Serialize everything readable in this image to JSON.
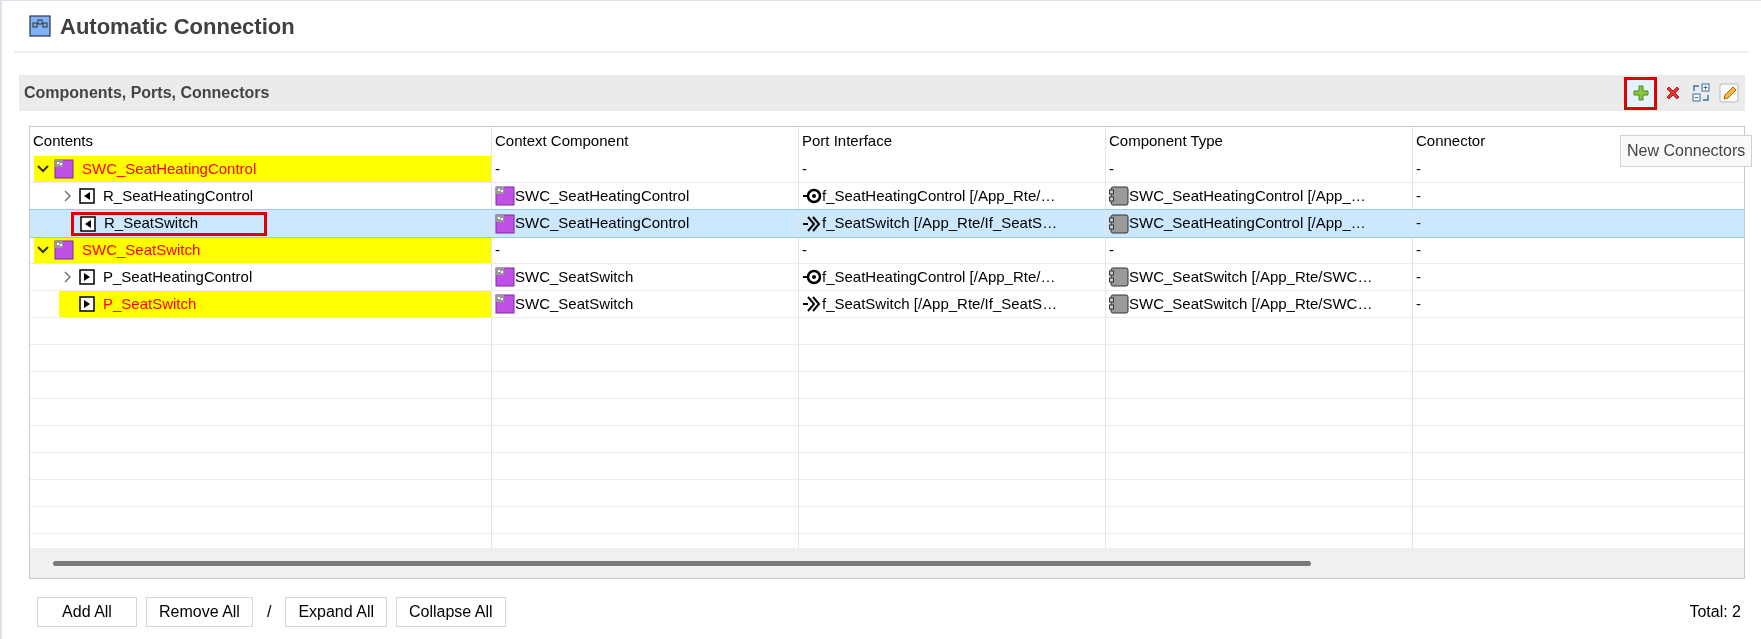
{
  "window": {
    "title": "Automatic Connection"
  },
  "section": {
    "title": "Components, Ports, Connectors"
  },
  "toolbar": [
    {
      "kind": "add",
      "marked": true
    },
    {
      "kind": "delete",
      "marked": false
    },
    {
      "kind": "expand-collapse",
      "marked": false
    },
    {
      "kind": "edit",
      "marked": false
    }
  ],
  "tooltip": "New Connectors",
  "table": {
    "columns": [
      "Contents",
      "Context Component",
      "Port Interface",
      "Component Type",
      "Connector"
    ],
    "rows": [
      {
        "kind": "component",
        "highlighted": true,
        "selected": false,
        "marked": false,
        "expanded": true,
        "cells": [
          {
            "text": "SWC_SeatHeatingControl"
          },
          {
            "text": "-"
          },
          {
            "text": "-"
          },
          {
            "text": "-"
          },
          {
            "text": "-"
          }
        ],
        "children": [
          {
            "kind": "r-port",
            "highlighted": false,
            "selected": false,
            "marked": false,
            "expanded": false,
            "cells": [
              {
                "text": "R_SeatHeatingControl"
              },
              {
                "text": "SWC_SeatHeatingControl"
              },
              {
                "text": "f_SeatHeatingControl [/App_Rte/…",
                "kind": "client-server"
              },
              {
                "text": "SWC_SeatHeatingControl [/App_…"
              },
              {
                "text": "-"
              }
            ]
          },
          {
            "kind": "r-port",
            "highlighted": false,
            "selected": true,
            "marked": true,
            "cells": [
              {
                "text": "R_SeatSwitch"
              },
              {
                "text": "SWC_SeatHeatingControl"
              },
              {
                "text": "f_SeatSwitch [/App_Rte/If_SeatS…",
                "kind": "sender-receiver"
              },
              {
                "text": "SWC_SeatHeatingControl [/App_…"
              },
              {
                "text": "-"
              }
            ]
          }
        ]
      },
      {
        "kind": "component",
        "highlighted": true,
        "selected": false,
        "marked": false,
        "expanded": true,
        "cells": [
          {
            "text": "SWC_SeatSwitch"
          },
          {
            "text": "-"
          },
          {
            "text": "-"
          },
          {
            "text": "-"
          },
          {
            "text": "-"
          }
        ],
        "children": [
          {
            "kind": "p-port",
            "highlighted": false,
            "selected": false,
            "marked": false,
            "expanded": false,
            "cells": [
              {
                "text": "P_SeatHeatingControl"
              },
              {
                "text": "SWC_SeatSwitch"
              },
              {
                "text": "f_SeatHeatingControl [/App_Rte/…",
                "kind": "client-server"
              },
              {
                "text": "SWC_SeatSwitch [/App_Rte/SWC…"
              },
              {
                "text": "-"
              }
            ]
          },
          {
            "kind": "p-port",
            "highlighted": true,
            "selected": false,
            "marked": false,
            "cells": [
              {
                "text": "P_SeatSwitch"
              },
              {
                "text": "SWC_SeatSwitch"
              },
              {
                "text": "f_SeatSwitch [/App_Rte/If_SeatS…",
                "kind": "sender-receiver"
              },
              {
                "text": "SWC_SeatSwitch [/App_Rte/SWC…"
              },
              {
                "text": "-"
              }
            ]
          }
        ]
      }
    ]
  },
  "buttons": [
    {
      "kind": "button",
      "label": "Add All"
    },
    {
      "kind": "button",
      "label": "Remove All"
    },
    {
      "kind": "separator",
      "label": "/"
    },
    {
      "kind": "button",
      "label": "Expand All"
    },
    {
      "kind": "button",
      "label": "Collapse All"
    }
  ],
  "total": "Total: 2"
}
